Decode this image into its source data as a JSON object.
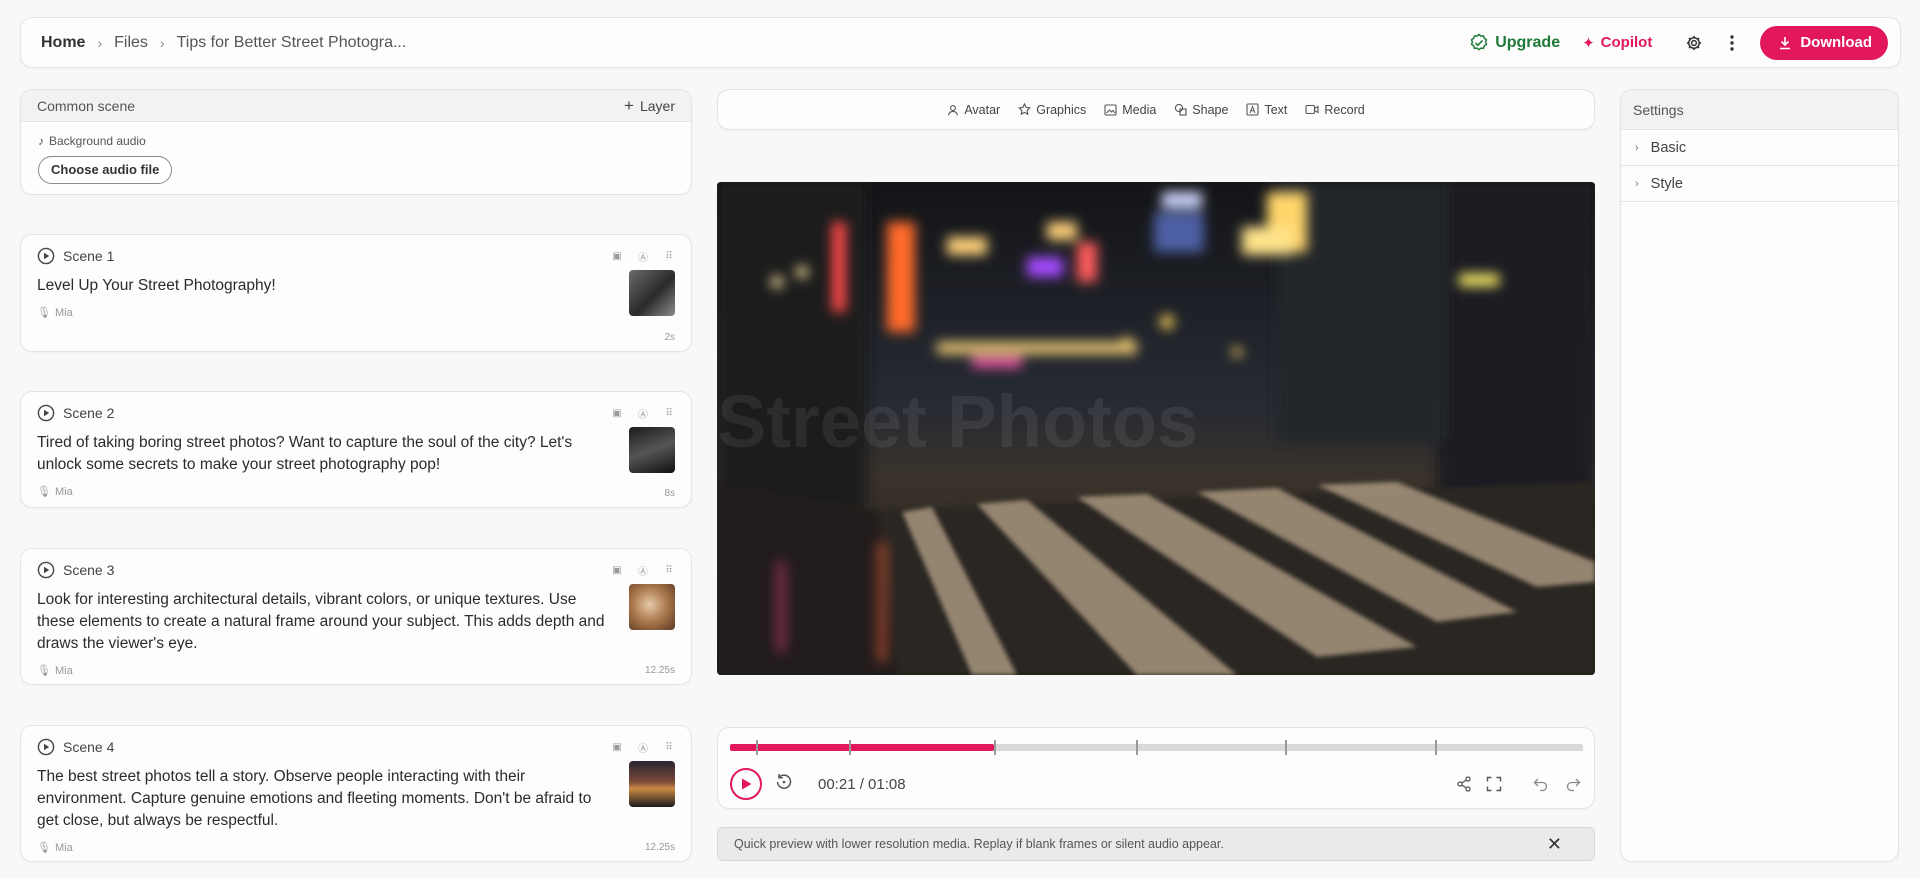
{
  "breadcrumb": {
    "home": "Home",
    "files": "Files",
    "current": "Tips for Better Street Photogra..."
  },
  "top_actions": {
    "upgrade_label": "Upgrade",
    "copilot_label": "Copilot",
    "download_label": "Download"
  },
  "common_scene": {
    "title": "Common scene",
    "layer_label": "Layer",
    "audio_label": "Background audio",
    "choose_audio": "Choose audio file"
  },
  "scenes": [
    {
      "label": "Scene 1",
      "text": "Level Up Your Street Photography!",
      "voice": "Mia",
      "duration": "2s"
    },
    {
      "label": "Scene 2",
      "text": "Tired of taking boring street photos? Want to capture the soul of the city? Let's unlock some secrets to make your street photography pop!",
      "voice": "Mia",
      "duration": "8s"
    },
    {
      "label": "Scene 3",
      "text": "Look for interesting architectural details, vibrant colors, or unique textures. Use these elements to create a natural frame around your subject. This adds depth and draws the viewer's eye.",
      "voice": "Mia",
      "duration": "12.25s"
    },
    {
      "label": "Scene 4",
      "text": "The best street photos tell a story. Observe people interacting with their environment. Capture genuine emotions and fleeting moments. Don't be afraid to get close, but always be respectful.",
      "voice": "Mia",
      "duration": "12.25s"
    }
  ],
  "toolbar": {
    "avatar": "Avatar",
    "graphics": "Graphics",
    "media": "Media",
    "shape": "Shape",
    "text": "Text",
    "record": "Record"
  },
  "preview": {
    "overlay_text": "Street Photos"
  },
  "player": {
    "time": "00:21 / 01:08",
    "progress": 0.31,
    "scene_markers": [
      0.03,
      0.14,
      0.31,
      0.476,
      0.651,
      0.826
    ]
  },
  "notice": {
    "text": "Quick preview with lower resolution media. Replay if blank frames or silent audio appear."
  },
  "settings": {
    "title": "Settings",
    "sections": [
      "Basic",
      "Style"
    ]
  },
  "colors": {
    "accent": "#e2185b",
    "upgrade": "#1f7a3a",
    "background": "#f7f8f7"
  }
}
